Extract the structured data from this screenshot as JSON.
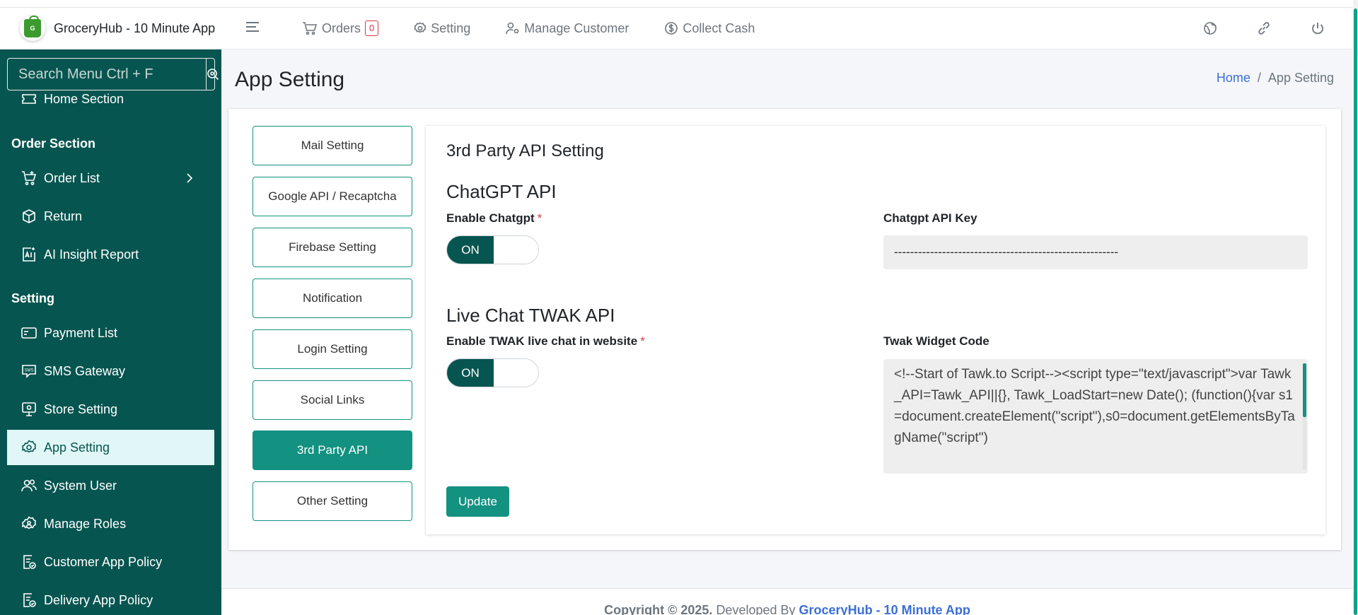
{
  "brand": {
    "name": "GroceryHub - 10 Minute App",
    "logo_text": "G"
  },
  "topnav": {
    "orders_label": "Orders",
    "orders_count": "0",
    "setting_label": "Setting",
    "manage_customer_label": "Manage Customer",
    "collect_cash_label": "Collect Cash"
  },
  "sidebar": {
    "search_placeholder": "Search Menu Ctrl + F",
    "home_section": "Home Section",
    "order_section_heading": "Order Section",
    "order_list": "Order List",
    "return": "Return",
    "ai_insight_report": "AI Insight Report",
    "setting_heading": "Setting",
    "payment_list": "Payment List",
    "sms_gateway": "SMS Gateway",
    "store_setting": "Store Setting",
    "app_setting": "App Setting",
    "system_user": "System User",
    "manage_roles": "Manage Roles",
    "customer_app_policy": "Customer App Policy",
    "delivery_app_policy": "Delivery App Policy"
  },
  "page": {
    "title": "App Setting",
    "breadcrumb_home": "Home",
    "breadcrumb_sep": "/",
    "breadcrumb_current": "App Setting"
  },
  "tabs": {
    "mail": "Mail Setting",
    "google": "Google API / Recaptcha",
    "firebase": "Firebase Setting",
    "notification": "Notification",
    "login": "Login Setting",
    "social": "Social Links",
    "third_party": "3rd Party API",
    "other": "Other Setting"
  },
  "panel": {
    "title": "3rd Party API Setting",
    "chatgpt_title": "ChatGPT API",
    "enable_chatgpt_label": "Enable Chatgpt",
    "required_mark": "*",
    "toggle_on": "ON",
    "chatgpt_key_label": "Chatgpt API Key",
    "chatgpt_key_value": "--------------------------------------------------------",
    "twak_title": "Live Chat TWAK API",
    "enable_twak_label": "Enable TWAK live chat in website",
    "twak_widget_label": "Twak Widget Code",
    "twak_widget_value": "<!--Start of Tawk.to Script--><script type=\"text/javascript\">var Tawk_API=Tawk_API||{}, Tawk_LoadStart=new Date(); (function(){var s1=document.createElement(\"script\"),s0=document.getElementsByTagName(\"script\")",
    "update_label": "Update"
  },
  "footer": {
    "copyright": "Copyright © 2025.",
    "developed_by": "Developed By",
    "brand_link": "GroceryHub - 10 Minute App"
  }
}
